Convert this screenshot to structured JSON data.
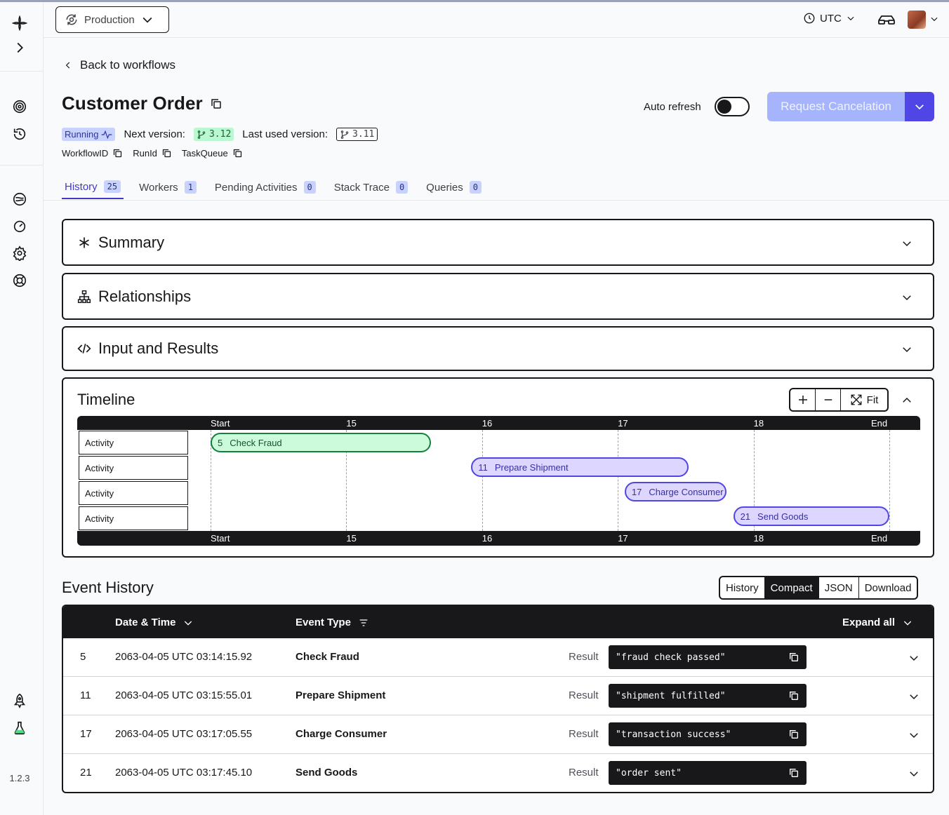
{
  "app": {
    "version": "1.2.3",
    "colors": {
      "accent": "#4f46e5",
      "dark": "#18181b",
      "running": "#c7d2fe",
      "success": "#bbf7d0"
    }
  },
  "header": {
    "namespace": "Production",
    "timezone": "UTC"
  },
  "page": {
    "back_label": "Back to workflows",
    "title": "Customer Order",
    "auto_refresh_label": "Auto refresh",
    "auto_refresh_on": false,
    "cancel_label": "Request Cancelation",
    "status": "Running",
    "next_version_label": "Next version:",
    "next_version": "3.12",
    "last_version_label": "Last used version:",
    "last_version": "3.11",
    "ids": [
      "WorkflowID",
      "RunId",
      "TaskQueue"
    ]
  },
  "tabs": [
    {
      "label": "History",
      "count": "25"
    },
    {
      "label": "Workers",
      "count": "1"
    },
    {
      "label": "Pending Activities",
      "count": "0"
    },
    {
      "label": "Stack Trace",
      "count": "0"
    },
    {
      "label": "Queries",
      "count": "0"
    }
  ],
  "sections": {
    "summary": "Summary",
    "relationships": "Relationships",
    "io": "Input and Results",
    "timeline": "Timeline"
  },
  "timeline": {
    "fit_label": "Fit",
    "ticks": [
      "Start",
      "15",
      "16",
      "17",
      "18",
      "End"
    ],
    "rows": [
      {
        "label": "Activity",
        "id": "5",
        "name": "Check Fraud",
        "status": "completed",
        "start": 0.0,
        "end": 1.625
      },
      {
        "label": "Activity",
        "id": "11",
        "name": "Prepare Shipment",
        "status": "running",
        "start": 1.92,
        "end": 3.52
      },
      {
        "label": "Activity",
        "id": "17",
        "name": "Charge Consumer",
        "status": "running",
        "start": 3.05,
        "end": 3.8
      },
      {
        "label": "Activity",
        "id": "21",
        "name": "Send Goods",
        "status": "running",
        "start": 3.85,
        "end": 5.0
      }
    ]
  },
  "event_history": {
    "title": "Event  History",
    "views": [
      "History",
      "Compact",
      "JSON",
      "Download"
    ],
    "active_view": "Compact",
    "columns": {
      "date": "Date & Time",
      "type": "Event Type",
      "expand": "Expand all"
    },
    "result_label": "Result",
    "rows": [
      {
        "id": "5",
        "date": "2063-04-05 UTC 03:14:15.92",
        "type": "Check Fraud",
        "result": "\"fraud check passed\""
      },
      {
        "id": "11",
        "date": "2063-04-05 UTC 03:15:55.01",
        "type": "Prepare Shipment",
        "result": "\"shipment fulfilled\""
      },
      {
        "id": "17",
        "date": "2063-04-05 UTC 03:17:05.55",
        "type": "Charge Consumer",
        "result": "\"transaction success\""
      },
      {
        "id": "21",
        "date": "2063-04-05 UTC 03:17:45.10",
        "type": "Send Goods",
        "result": "\"order sent\""
      }
    ]
  }
}
